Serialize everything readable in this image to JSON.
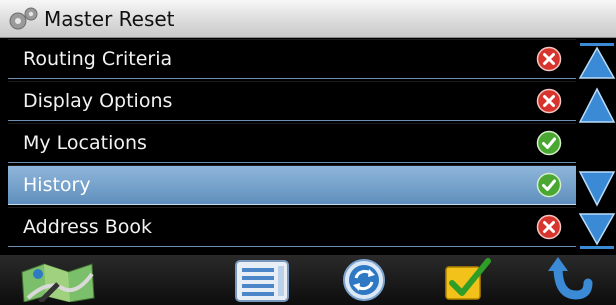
{
  "title": {
    "text": "Master Reset",
    "icon": "gears-icon"
  },
  "items": [
    {
      "label": "Routing Criteria",
      "status": "reset-x-icon",
      "selected": false
    },
    {
      "label": "Display Options",
      "status": "reset-x-icon",
      "selected": false
    },
    {
      "label": "My Locations",
      "status": "keep-check-icon",
      "selected": false
    },
    {
      "label": "History",
      "status": "keep-check-icon",
      "selected": true
    },
    {
      "label": "Address Book",
      "status": "reset-x-icon",
      "selected": false
    }
  ],
  "scroll": {
    "buttons": [
      "scroll-top-icon",
      "page-up-icon",
      "page-down-icon",
      "scroll-bottom-icon"
    ]
  },
  "toolbar": {
    "buttons": [
      "map-icon",
      "menu-list-icon",
      "refresh-icon",
      "confirm-check-icon",
      "back-arrow-icon"
    ]
  },
  "colors": {
    "selected_row": "#6f9cc8",
    "row_divider": "#6c8fb2",
    "reset_red": "#d6342c",
    "keep_green": "#4aa832",
    "arrow_blue": "#3a8ad6"
  }
}
